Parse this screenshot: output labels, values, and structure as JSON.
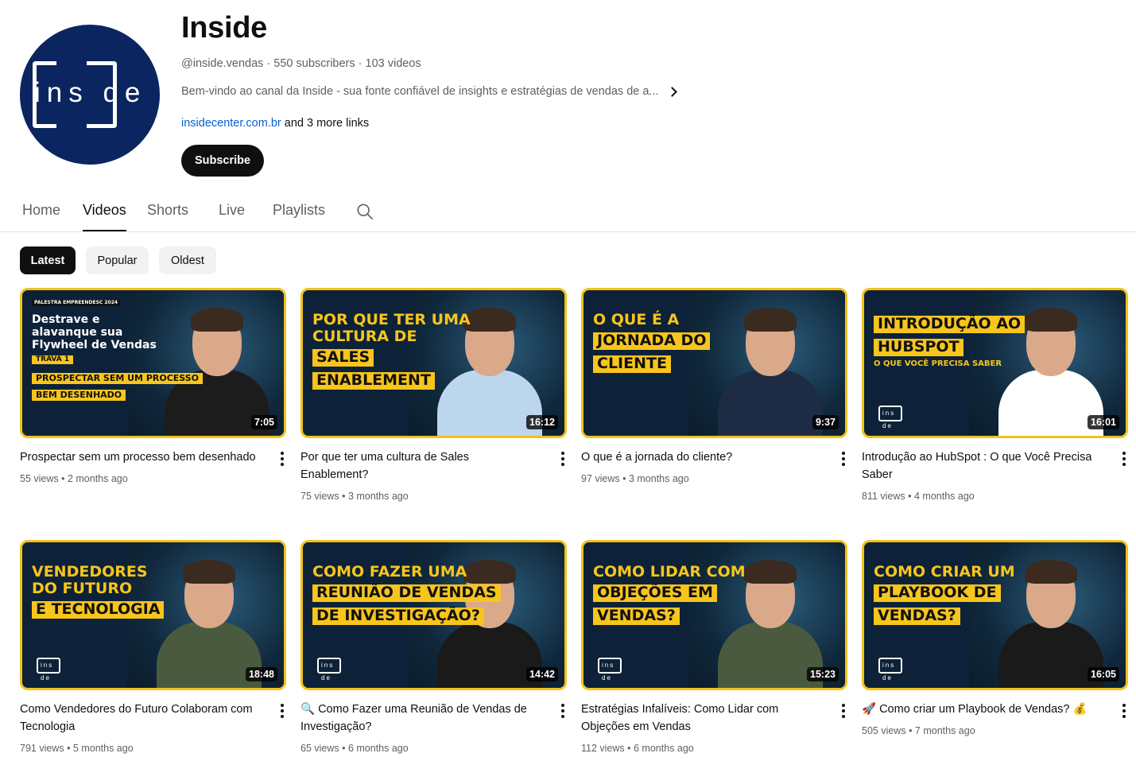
{
  "channel": {
    "name": "Inside",
    "logo_text": "ins de",
    "handle": "@inside.vendas",
    "subscribers": "550 subscribers",
    "videos_count": "103 videos",
    "description": "Bem-vindo ao canal da Inside - sua fonte confiável de insights e estratégias de vendas de a...",
    "link": "insidecenter.com.br",
    "more_links": "and 3 more links",
    "subscribe_label": "Subscribe",
    "brand_color": "#0b2560"
  },
  "tabs": [
    {
      "label": "Home"
    },
    {
      "label": "Videos",
      "active": true
    },
    {
      "label": "Shorts"
    },
    {
      "label": "Live"
    },
    {
      "label": "Playlists"
    }
  ],
  "chips": [
    {
      "label": "Latest",
      "active": true
    },
    {
      "label": "Popular"
    },
    {
      "label": "Oldest"
    }
  ],
  "videos": [
    {
      "title": "Prospectar sem um processo bem desenhado",
      "views": "55 views",
      "age": "2 months ago",
      "duration": "7:05",
      "thumb": {
        "tag": "PALESTRA EMPREENDESC 2024",
        "lines": [
          "Destrave e",
          "alavanque sua",
          "Flywheel de Vendas"
        ],
        "badge": "TRAVA 1",
        "hl": [
          "PROSPECTAR SEM UM PROCESSO",
          "BEM DESENHADO"
        ],
        "logo": ""
      }
    },
    {
      "title": "Por que ter uma cultura de Sales Enablement?",
      "views": "75 views",
      "age": "3 months ago",
      "duration": "16:12",
      "thumb": {
        "lines": [
          "POR QUE TER UMA",
          "CULTURA DE"
        ],
        "hl": [
          "SALES",
          "ENABLEMENT"
        ],
        "logo": ""
      }
    },
    {
      "title": "O que é a jornada do cliente?",
      "views": "97 views",
      "age": "3 months ago",
      "duration": "9:37",
      "thumb": {
        "lines": [
          "O QUE É A"
        ],
        "hl": [
          "JORNADA DO",
          "CLIENTE"
        ],
        "logo": ""
      }
    },
    {
      "title": "Introdução ao HubSpot : O que Você Precisa Saber",
      "views": "811 views",
      "age": "4 months ago",
      "duration": "16:01",
      "thumb": {
        "lines": [],
        "hl": [
          "INTRODUÇÃO AO",
          "HUBSPOT"
        ],
        "sub": "O QUE VOCÊ PRECISA SABER",
        "logo": "ins de"
      }
    },
    {
      "title": "Como Vendedores do Futuro Colaboram com Tecnologia",
      "views": "791 views",
      "age": "5 months ago",
      "duration": "18:48",
      "thumb": {
        "lines": [
          "VENDEDORES",
          "DO FUTURO"
        ],
        "hl": [
          "E TECNOLOGIA"
        ],
        "logo": "ins de"
      }
    },
    {
      "title": "🔍 Como Fazer uma Reunião de Vendas de Investigação?",
      "views": "65 views",
      "age": "6 months ago",
      "duration": "14:42",
      "thumb": {
        "lines": [
          "COMO FAZER UMA"
        ],
        "hl": [
          "REUNIÃO DE VENDAS",
          "DE INVESTIGAÇÃO?"
        ],
        "logo": "ins de"
      }
    },
    {
      "title": "Estratégias Infalíveis: Como Lidar com Objeções em Vendas",
      "views": "112 views",
      "age": "6 months ago",
      "duration": "15:23",
      "thumb": {
        "lines": [
          "COMO LIDAR COM"
        ],
        "hl": [
          "OBJEÇÕES EM",
          "VENDAS?"
        ],
        "logo": "ins de"
      }
    },
    {
      "title": "🚀 Como criar um Playbook de Vendas? 💰",
      "views": "505 views",
      "age": "7 months ago",
      "duration": "16:05",
      "thumb": {
        "lines": [
          "COMO CRIAR UM"
        ],
        "hl": [
          "PLAYBOOK DE",
          "VENDAS?"
        ],
        "logo": "ins de"
      }
    }
  ]
}
